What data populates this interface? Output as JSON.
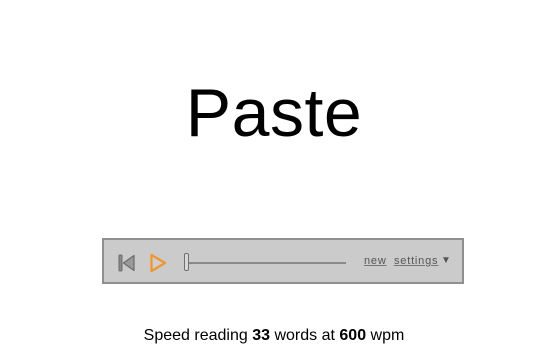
{
  "display": {
    "word": "Paste"
  },
  "controls": {
    "rewind_icon": "skip-back-icon",
    "play_icon": "play-icon",
    "progress": 0,
    "new_label": "new",
    "settings_label": "settings",
    "settings_arrow": "▼",
    "accent_color": "#f0962a",
    "icon_color": "#7f7f7f"
  },
  "status": {
    "prefix": "Speed reading",
    "word_count": "33",
    "middle": "words at",
    "wpm": "600",
    "suffix": "wpm"
  }
}
